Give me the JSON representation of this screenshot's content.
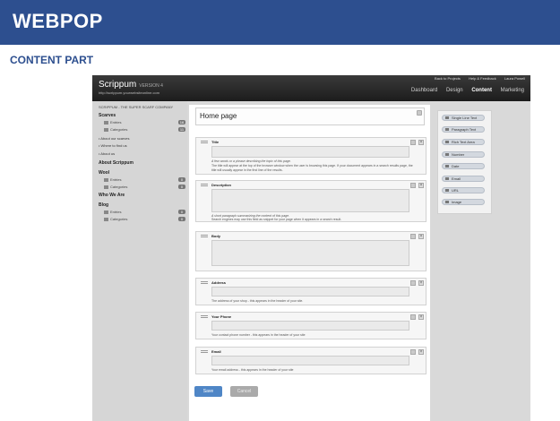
{
  "slide": {
    "title": "WEBPOP",
    "section": "CONTENT PART"
  },
  "app": {
    "brand": "Scrippum",
    "version": "VERSION 4",
    "url": "http://scrippum.yourwebsiteonline.com",
    "top_links": [
      "Back to Projects",
      "Help & Feedback",
      "Laura Powell"
    ],
    "nav": [
      "Dashboard",
      "Design",
      "Content",
      "Marketing"
    ],
    "active_nav": "Content"
  },
  "sidebar": {
    "company": "SCRIPPUM - THE SUPER SCARF COMPANY",
    "sections": {
      "scarves": "Scarves",
      "scarves_entries": "Entries",
      "scarves_entries_count": "16",
      "scarves_categories": "Categories",
      "scarves_categories_count": "11",
      "link_about_scarves": "• About our scarves",
      "link_where": "• Where to find us",
      "link_about_us": "• About us",
      "about": "About Scrippum",
      "wool": "Wool",
      "wool_entries": "Entries",
      "wool_entries_count": "0",
      "wool_categories": "Categories",
      "wool_categories_count": "0",
      "who": "Who We Are",
      "blog": "Blog",
      "blog_entries": "Entries",
      "blog_entries_count": "0",
      "blog_categories": "Categories",
      "blog_categories_count": "0"
    }
  },
  "editor": {
    "page_title": "Home page",
    "fields": {
      "title_label": "Title",
      "title_hint1": "A few words or a phrase describing the topic of this page.",
      "title_hint2": "The title will appear at the top of the browser window when the user is browsing this page. If your document appears in a search results page, the title will usually appear in the first line of the results.",
      "description_label": "Description",
      "description_hint1": "A short paragraph summarizing the content of this page.",
      "description_hint2": "Search engines may use this field as snippet for your page when it appears in a search result.",
      "body_label": "Body",
      "address_label": "Address",
      "address_hint": "The address of your shop - this appears in the header of your site.",
      "phone_label": "Your Phone",
      "phone_hint": "Your contact phone number - this appears in the header of your site",
      "email_label": "Email",
      "email_hint": "Your email address - this appears in the header of your site"
    },
    "save_label": "Save",
    "cancel_label": "Cancel"
  },
  "palette": {
    "items": [
      "Single Line Text",
      "Paragraph Text",
      "Rich Text Area",
      "Number",
      "Date",
      "Email",
      "URL",
      "Image"
    ]
  },
  "colors": {
    "banner": "#2d4f8f",
    "save": "#4f86c6"
  }
}
